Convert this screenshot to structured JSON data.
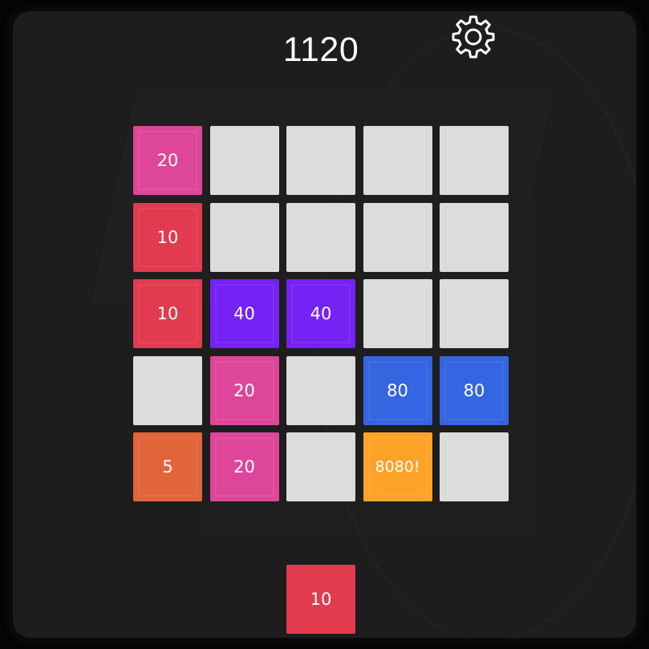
{
  "score": "1120",
  "settings_icon": "gear-icon",
  "colors": {
    "empty": "#dcdcdc",
    "5": "#e2643a",
    "10": "#e23a4e",
    "20": "#de4699",
    "40": "#7522f5",
    "80": "#3565e0",
    "8080!": "#ffa228"
  },
  "board": [
    [
      "20",
      "",
      "",
      "",
      ""
    ],
    [
      "10",
      "",
      "",
      "",
      ""
    ],
    [
      "10",
      "40",
      "40",
      "",
      ""
    ],
    [
      "",
      "20",
      "",
      "80",
      "80"
    ],
    [
      "5",
      "20",
      "",
      "8080!",
      ""
    ]
  ],
  "next_tile": "10"
}
